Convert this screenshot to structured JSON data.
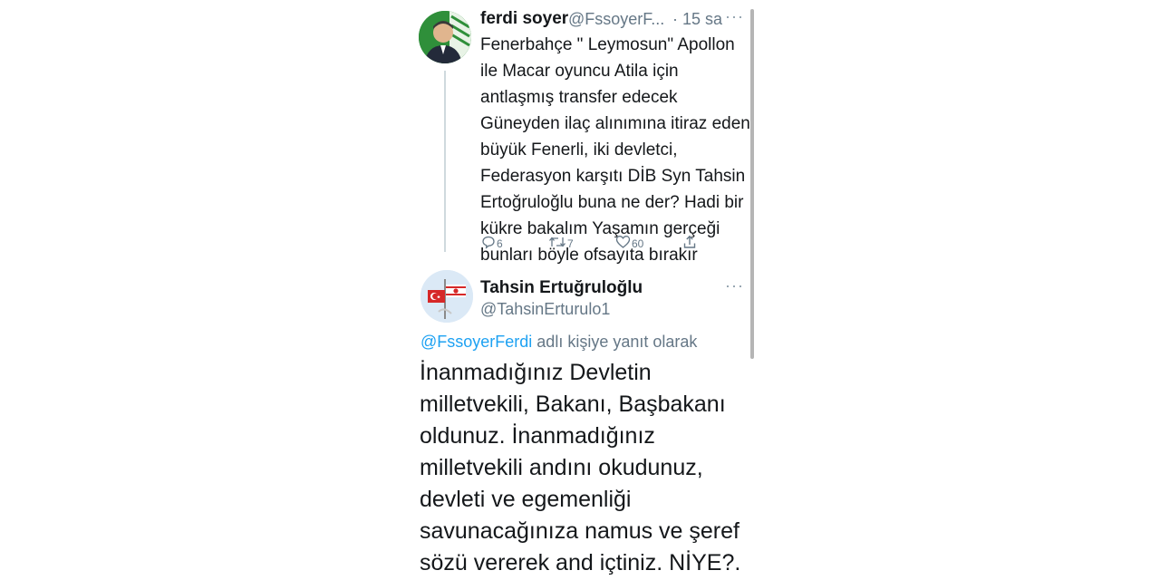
{
  "tweet1": {
    "name": "ferdi soyer",
    "handle": "@FssoyerF...",
    "time": "· 15 sa",
    "more": "···",
    "lines": [
      "Fenerbahçe \" Leymosun\" Apollon",
      "ile Macar oyuncu Atila için",
      "antlaşmış transfer edecek",
      "Güneyden ilaç alınımına itiraz eden",
      "büyük Fenerli, iki devletci,",
      "Federasyon karşıtı DİB Syn Tahsin",
      "Ertoğruloğlu buna ne der? Hadi bir",
      "kükre bakalım Yaşamın gerçeği",
      "bunları böyle ofsayıta bırakır"
    ],
    "actions": {
      "reply_count": "6",
      "retweet_count": "7",
      "like_count": "60"
    }
  },
  "tweet2": {
    "name": "Tahsin Ertuğruloğlu",
    "handle": "@TahsinErturulo1",
    "more": "···",
    "reply_to_handle": "@FssoyerFerdi",
    "reply_to_suffix": " adlı kişiye yanıt olarak",
    "lines": [
      "İnanmadığınız Devletin",
      "milletvekili, Bakanı, Başbakanı",
      "oldunuz. İnanmadığınız",
      "milletvekili andını okudunuz,",
      "devleti ve egemenliği",
      "savunacağınıza namus ve şeref",
      "sözü vererek and içtiniz. NİYE?."
    ]
  },
  "colors": {
    "text": "#14171a",
    "secondary": "#657786",
    "link": "#1da1f2",
    "thread_line": "#cfd9de"
  },
  "icons": [
    "reply-icon",
    "retweet-icon",
    "like-icon",
    "share-icon",
    "more-icon"
  ]
}
